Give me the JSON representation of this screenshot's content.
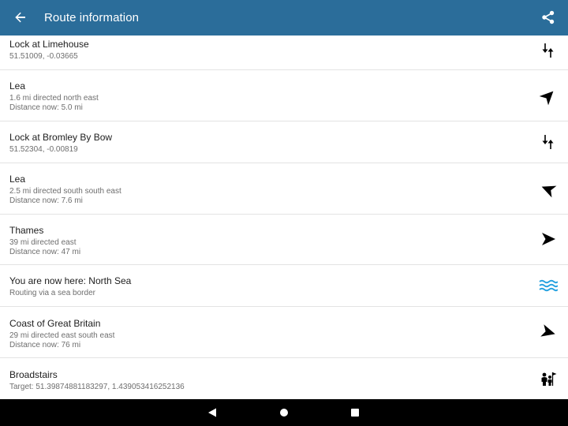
{
  "appbar": {
    "title": "Route information"
  },
  "rows": [
    {
      "title": "Lock at Limehouse",
      "line1": "51.51009, -0.03665",
      "line2": "",
      "icon": "lock-transfer-icon"
    },
    {
      "title": "Lea",
      "line1": "1.6 mi directed north east",
      "line2": "Distance now: 5.0 mi",
      "icon": "direction-arrow-icon"
    },
    {
      "title": "Lock at Bromley By Bow",
      "line1": "51.52304, -0.00819",
      "line2": "",
      "icon": "lock-transfer-icon"
    },
    {
      "title": "Lea",
      "line1": "2.5 mi directed south south east",
      "line2": "Distance now: 7.6 mi",
      "icon": "direction-arrow-icon"
    },
    {
      "title": "Thames",
      "line1": "39 mi directed east",
      "line2": "Distance now: 47 mi",
      "icon": "direction-arrow-icon"
    },
    {
      "title": "You are now here: North Sea",
      "line1": "Routing via a sea border",
      "line2": "",
      "icon": "sea-waves-icon"
    },
    {
      "title": "Coast of Great Britain",
      "line1": "29 mi directed east south east",
      "line2": "Distance now: 76 mi",
      "icon": "direction-arrow-icon"
    },
    {
      "title": "Broadstairs",
      "line1": "Target: 51.39874881183297, 1.439053416252136",
      "line2": "",
      "icon": "destination-flag-icon"
    }
  ],
  "colors": {
    "appbar": "#2b6d9a",
    "waves": "#29a3e0"
  }
}
